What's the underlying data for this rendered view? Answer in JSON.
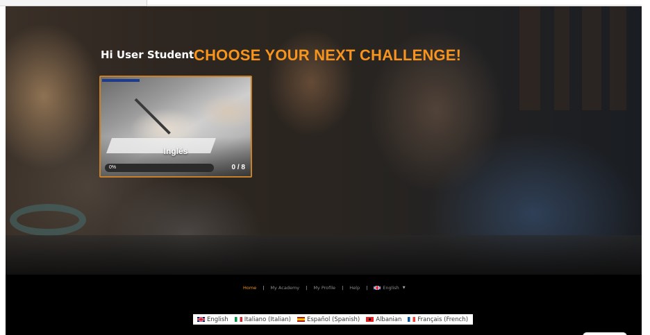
{
  "hero": {
    "greeting": "Hi User Student",
    "title": "CHOOSE YOUR NEXT CHALLENGE!"
  },
  "course_card": {
    "title": "Inglés",
    "progress_label": "0%",
    "progress_fraction": 0,
    "count": "0 / 8"
  },
  "footer": {
    "nav": [
      {
        "label": "Home",
        "active": true
      },
      {
        "label": "My Academy",
        "active": false
      },
      {
        "label": "My Profile",
        "active": false
      },
      {
        "label": "Help",
        "active": false
      }
    ],
    "current_language": "English"
  },
  "language_bar": [
    {
      "label": "English",
      "flag": "uk-flag-icon"
    },
    {
      "label": "Italiano (Italian)",
      "flag": "italy-flag-icon"
    },
    {
      "label": "Español (Spanish)",
      "flag": "spain-flag-icon"
    },
    {
      "label": "Albanian",
      "flag": "albania-flag-icon"
    },
    {
      "label": "Français (French)",
      "flag": "france-flag-icon"
    }
  ],
  "colors": {
    "accent": "#f7941d",
    "card_border": "#c9802a",
    "footer_bg": "#000000"
  }
}
